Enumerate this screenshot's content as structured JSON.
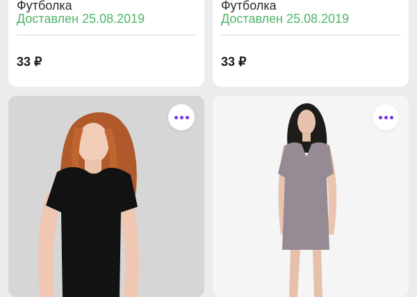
{
  "products": [
    {
      "name": "Футболка",
      "status": "Доставлен 25.08.2019",
      "price": "33 ₽"
    },
    {
      "name": "Футболка",
      "status": "Доставлен 25.08.2019",
      "price": "33 ₽"
    }
  ],
  "colors": {
    "accent": "#7a2fe0",
    "status_green": "#4cb567",
    "background": "#ececef"
  },
  "icons": {
    "more": "more-horizontal-icon"
  }
}
